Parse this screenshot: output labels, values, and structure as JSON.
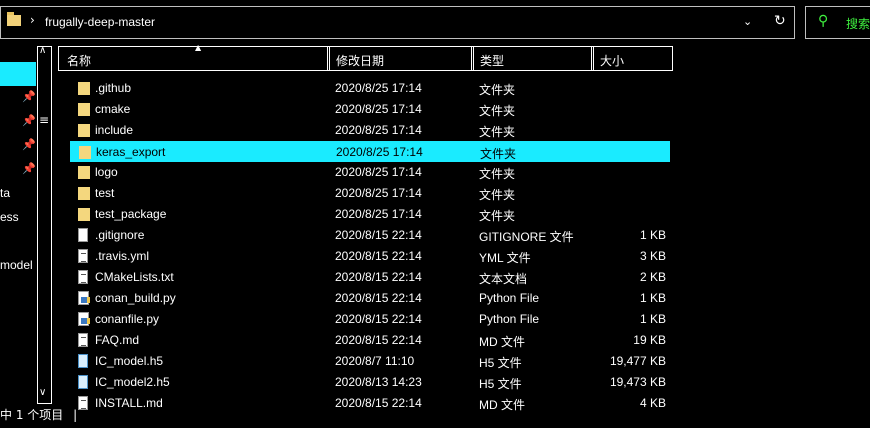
{
  "address_bar": {
    "path": "frugally-deep-master",
    "separator": "›"
  },
  "search": {
    "placeholder": "搜索"
  },
  "nav": {
    "items": [
      {
        "label": "ta"
      },
      {
        "label": "ess"
      },
      {
        "label": "model"
      }
    ]
  },
  "columns": {
    "name": "名称",
    "date": "修改日期",
    "type": "类型",
    "size": "大小"
  },
  "files": [
    {
      "name": ".github",
      "date": "2020/8/25 17:14",
      "type": "文件夹",
      "size": "",
      "icon": "folder"
    },
    {
      "name": "cmake",
      "date": "2020/8/25 17:14",
      "type": "文件夹",
      "size": "",
      "icon": "folder"
    },
    {
      "name": "include",
      "date": "2020/8/25 17:14",
      "type": "文件夹",
      "size": "",
      "icon": "folder"
    },
    {
      "name": "keras_export",
      "date": "2020/8/25 17:14",
      "type": "文件夹",
      "size": "",
      "icon": "folder",
      "selected": true
    },
    {
      "name": "logo",
      "date": "2020/8/25 17:14",
      "type": "文件夹",
      "size": "",
      "icon": "folder"
    },
    {
      "name": "test",
      "date": "2020/8/25 17:14",
      "type": "文件夹",
      "size": "",
      "icon": "folder"
    },
    {
      "name": "test_package",
      "date": "2020/8/25 17:14",
      "type": "文件夹",
      "size": "",
      "icon": "folder"
    },
    {
      "name": ".gitignore",
      "date": "2020/8/15 22:14",
      "type": "GITIGNORE 文件",
      "size": "1 KB",
      "icon": "file"
    },
    {
      "name": ".travis.yml",
      "date": "2020/8/15 22:14",
      "type": "YML 文件",
      "size": "3 KB",
      "icon": "text"
    },
    {
      "name": "CMakeLists.txt",
      "date": "2020/8/15 22:14",
      "type": "文本文档",
      "size": "2 KB",
      "icon": "text"
    },
    {
      "name": "conan_build.py",
      "date": "2020/8/15 22:14",
      "type": "Python File",
      "size": "1 KB",
      "icon": "python"
    },
    {
      "name": "conanfile.py",
      "date": "2020/8/15 22:14",
      "type": "Python File",
      "size": "1 KB",
      "icon": "python"
    },
    {
      "name": "FAQ.md",
      "date": "2020/8/15 22:14",
      "type": "MD 文件",
      "size": "19 KB",
      "icon": "text"
    },
    {
      "name": "IC_model.h5",
      "date": "2020/8/7 11:10",
      "type": "H5 文件",
      "size": "19,477 KB",
      "icon": "h5"
    },
    {
      "name": "IC_model2.h5",
      "date": "2020/8/13 14:23",
      "type": "H5 文件",
      "size": "19,473 KB",
      "icon": "h5"
    },
    {
      "name": "INSTALL.md",
      "date": "2020/8/15 22:14",
      "type": "MD 文件",
      "size": "4 KB",
      "icon": "text"
    }
  ],
  "status": {
    "text": "中 1 个项目",
    "divider": "|"
  }
}
